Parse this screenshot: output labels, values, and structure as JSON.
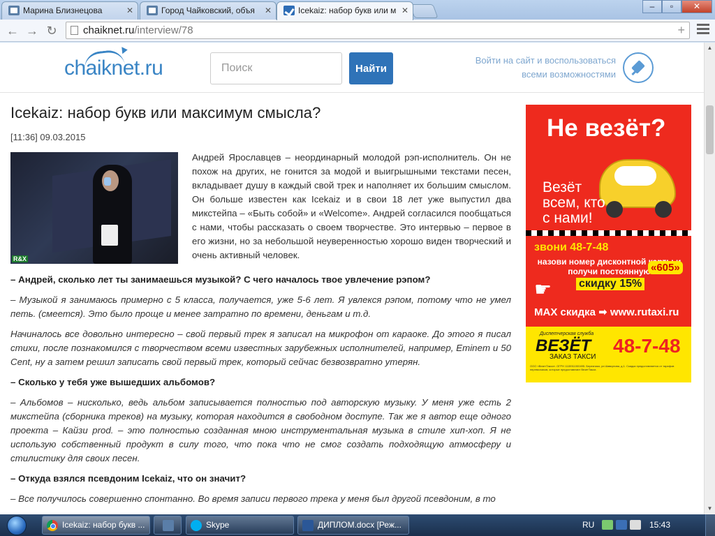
{
  "browser": {
    "tabs": [
      {
        "label": "Марина Близнецова",
        "icon": "vk-icon"
      },
      {
        "label": "Город Чайковский, объя",
        "icon": "vk-icon"
      },
      {
        "label": "Icekaiz: набор букв или м",
        "icon": "chaiknet-icon",
        "active": true
      }
    ],
    "address": {
      "domain": "chaiknet.ru",
      "path": "/interview/78"
    }
  },
  "site": {
    "logo": "chaiknet.ru",
    "search": {
      "placeholder": "Поиск",
      "button": "Найти"
    },
    "login_line1": "Войти на сайт и воспользоваться",
    "login_line2": "всеми возможностями"
  },
  "article": {
    "title": "Icekaiz: набор букв или максимум смысла?",
    "date": "[11:36] 09.03.2015",
    "intro": "Андрей Ярославцев – неординарный молодой рэп-исполнитель. Он не похож на других, не гонится за модой и выигрышными текстами песен, вкладывает душу в каждый свой трек и наполняет их большим смыслом. Он больше известен как Icekaiz и в свои 18 лет уже выпустил два микстейпа – «Быть собой» и «Welcome». Андрей согласился пообщаться с нами, чтобы рассказать о своем творчестве. Это интервью – первое в его жизни, но за небольшой неуверенностью хорошо виден творческий и очень активный человек.",
    "q1": "– Андрей, сколько лет ты занимаешься музыкой? С чего началось твое увлечение рэпом?",
    "a1": "– Музыкой я занимаюсь примерно с 5 класса, получается, уже 5-6 лет. Я увлекся рэпом, потому что не умел петь. (смеется). Это было проще и менее затратно по времени, деньгам и т.д.",
    "a1b": "Начиналось все довольно интересно – свой первый трек я записал на микрофон от караоке. До этого я писал стихи, после познакомился с творчеством всеми известных зарубежных исполнителей, например, Eminem и 50 Cent, ну а затем решил записать свой первый трек, который сейчас безвозвратно утерян.",
    "q2": "– Сколько у тебя уже вышедших альбомов?",
    "a2": "– Альбомов – нисколько, ведь альбом записывается полностью под авторскую музыку. У меня уже есть 2 микстейпа (сборника треков) на музыку, которая находится в свободном доступе. Так же я автор еще одного проекта – Кайзи prod. – это полностью созданная мною инструментальная музыка в стиле хип-хоп. Я не использую собственный продукт в силу того, что пока что не смог создать подходящую атмосферу и стилистику для своих песен.",
    "q3": "– Откуда взялся псевдоним Icekaiz, что он значит?",
    "a3": "– Все получилось совершенно спонтанно. Во время записи первого трека у меня был другой псевдоним, в то"
  },
  "ad": {
    "headline": "Не везёт?",
    "slogan": "Везёт всем, кто с нами!",
    "call": "звони 48-7-48",
    "discount_line": "назови номер дисконтной карты и получи постоянную",
    "code": "«605»",
    "discount": "скидку 15%",
    "max": "MAX скидка ➡ www.rutaxi.ru",
    "dispatch": "Диспетчерская служба",
    "brand": "ВЕЗЁТ",
    "order": "ЗАКАЗ ТАКСИ",
    "phone": "48-7-48",
    "fine": "ООО «ВезетТакси». ОГРН 1115911000495. Березники, ул.Шавкунова, д.1. Скидка предоставляется от тарифов перевозчиков, которые предоставляют ВезетТакси."
  },
  "taskbar": {
    "items": [
      {
        "label": "Icekaiz: набор букв ...",
        "icon": "chrome-icon"
      },
      {
        "label": "",
        "icon": "x-icon"
      },
      {
        "label": "Skype",
        "icon": "skype-icon"
      },
      {
        "label": "ДИПЛОМ.docx [Реж...",
        "icon": "word-icon"
      }
    ],
    "lang": "RU",
    "time": "15:43"
  }
}
